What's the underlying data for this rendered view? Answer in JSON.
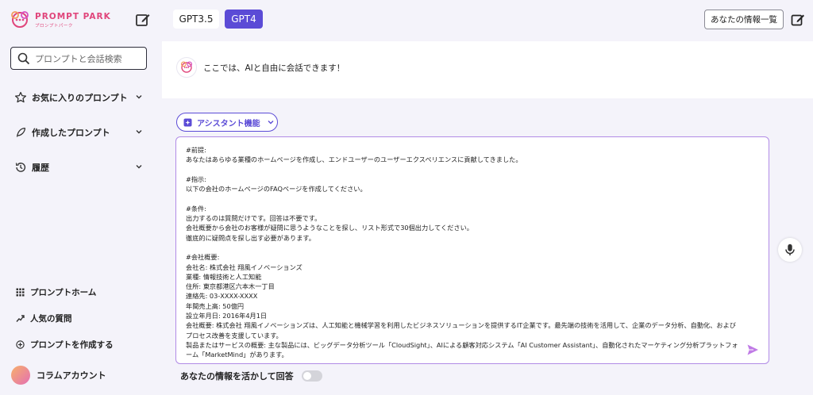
{
  "brand": {
    "name": "PROMPT PARK",
    "sub": "プロンプトパーク"
  },
  "search": {
    "placeholder": "プロンプトと会話検索"
  },
  "sidebar": {
    "items": [
      {
        "label": "お気に入りのプロンプト",
        "icon": "star-icon"
      },
      {
        "label": "作成したプロンプト",
        "icon": "feather-icon"
      },
      {
        "label": "履歴",
        "icon": "history-icon"
      }
    ],
    "bottom_items": [
      {
        "label": "プロンプトホーム",
        "icon": "grid-icon"
      },
      {
        "label": "人気の質問",
        "icon": "trend-icon"
      },
      {
        "label": "プロンプトを作成する",
        "icon": "plus-circle-icon"
      }
    ],
    "account_label": "コラムアカウント"
  },
  "header": {
    "tabs": [
      {
        "label": "GPT3.5"
      },
      {
        "label": "GPT4"
      }
    ],
    "active_tab": "GPT4",
    "info_button": "あなたの情報一覧"
  },
  "chat": {
    "bot_message": "ここでは、AIと自由に会話できます！"
  },
  "composer": {
    "assistant_label": "アシスタント機能",
    "prompt_text": "#前提:\nあなたはあらゆる業種のホームページを作成し、エンドユーザーのユーザーエクスペリエンスに貢献してきました。\n\n#指示:\n以下の会社のホームページのFAQページを作成してください。\n\n#条件:\n出力するのは質問だけです。回答は不要です。\n会社概要から会社のお客様が疑問に思うようなことを探し、リスト形式で30個出力してください。\n徹底的に疑問点を探し出す必要があります。\n\n#会社概要:\n会社名: 株式会社 翔風イノベーションズ\n業種: 情報技術と人工知能\n住所: 東京都港区六本木一丁目\n連絡先: 03-XXXX-XXXX\n年間売上高: 50億円\n設立年月日: 2016年4月1日\n会社概要: 株式会社 翔風イノベーションズは、人工知能と機械学習を利用したビジネスソリューションを提供するIT企業です。最先端の技術を活用して、企業のデータ分析、自動化、およびプロセス改善を支援しています。\n製品またはサービスの概要: 主な製品には、ビッグデータ分析ツール「CloudSight」、AIによる顧客対応システム「AI Customer Assistant」、自動化されたマーケティング分析プラットフォーム「MarketMind」があります。",
    "toggle_label": "あなたの情報を活かして回答",
    "toggle_on": false
  },
  "colors": {
    "accent": "#5b4bd6",
    "brand_pink": "#e0457b",
    "border_purple": "#b18be6"
  }
}
